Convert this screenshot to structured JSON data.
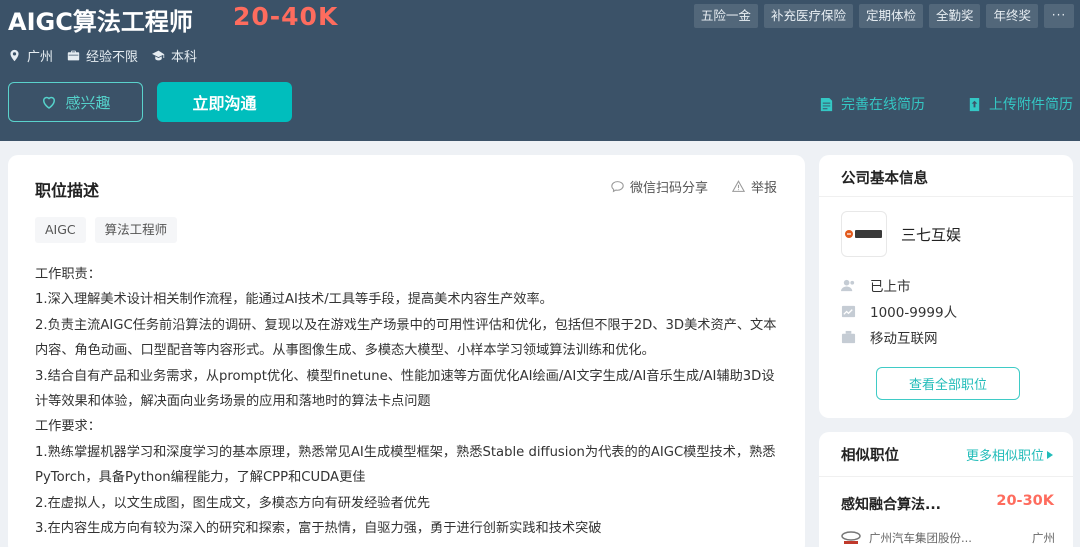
{
  "job": {
    "title": "AIGC算法工程师",
    "salary": "20-40K",
    "meta": {
      "city": "广州",
      "experience": "经验不限",
      "education": "本科"
    }
  },
  "benefits": [
    "五险一金",
    "补充医疗保险",
    "定期体检",
    "全勤奖",
    "年终奖"
  ],
  "benefits_more": "···",
  "actions": {
    "interest_label": "感兴趣",
    "chat_label": "立即沟通",
    "complete_resume": "完善在线简历",
    "upload_resume": "上传附件简历"
  },
  "description": {
    "title": "职位描述",
    "share_label": "微信扫码分享",
    "report_label": "举报",
    "keywords": [
      "AIGC",
      "算法工程师"
    ],
    "lines": [
      "工作职责：",
      "1.深入理解美术设计相关制作流程，能通过AI技术/工具等手段，提高美术内容生产效率。",
      "2.负责主流AIGC任务前沿算法的调研、复现以及在游戏生产场景中的可用性评估和优化，包括但不限于2D、3D美术资产、文本内容、角色动画、口型配音等内容形式。从事图像生成、多模态大模型、小样本学习领域算法训练和优化。",
      "3.结合自有产品和业务需求，从prompt优化、模型finetune、性能加速等方面优化AI绘画/AI文字生成/AI音乐生成/AI辅助3D设计等效果和体验，解决面向业务场景的应用和落地时的算法卡点问题",
      "工作要求：",
      "1.熟练掌握机器学习和深度学习的基本原理，熟悉常见AI生成模型框架，熟悉Stable diffusion为代表的的AIGC模型技术，熟悉PyTorch，具备Python编程能力，了解CPP和CUDA更佳",
      "2.在虚拟人，以文生成图，图生成文，多模态方向有研发经验者优先",
      "3.在内容生成方向有较为深入的研究和探索，富于热情，自驱力强，勇于进行创新实践和技术突破"
    ]
  },
  "company": {
    "section_title": "公司基本信息",
    "name": "三七互娱",
    "logo_text": "三七互娱",
    "stage": "已上市",
    "size": "1000-9999人",
    "industry": "移动互联网",
    "all_jobs_label": "查看全部职位"
  },
  "similar": {
    "section_title": "相似职位",
    "more_label": "更多相似职位",
    "items": [
      {
        "title": "感知融合算法...",
        "salary": "20-30K",
        "company": "广州汽车集团股份...",
        "city": "广州"
      }
    ]
  },
  "colors": {
    "header_bg": "#3b5268",
    "accent_teal": "#00bebd",
    "salary_red": "#fe6c5e"
  }
}
